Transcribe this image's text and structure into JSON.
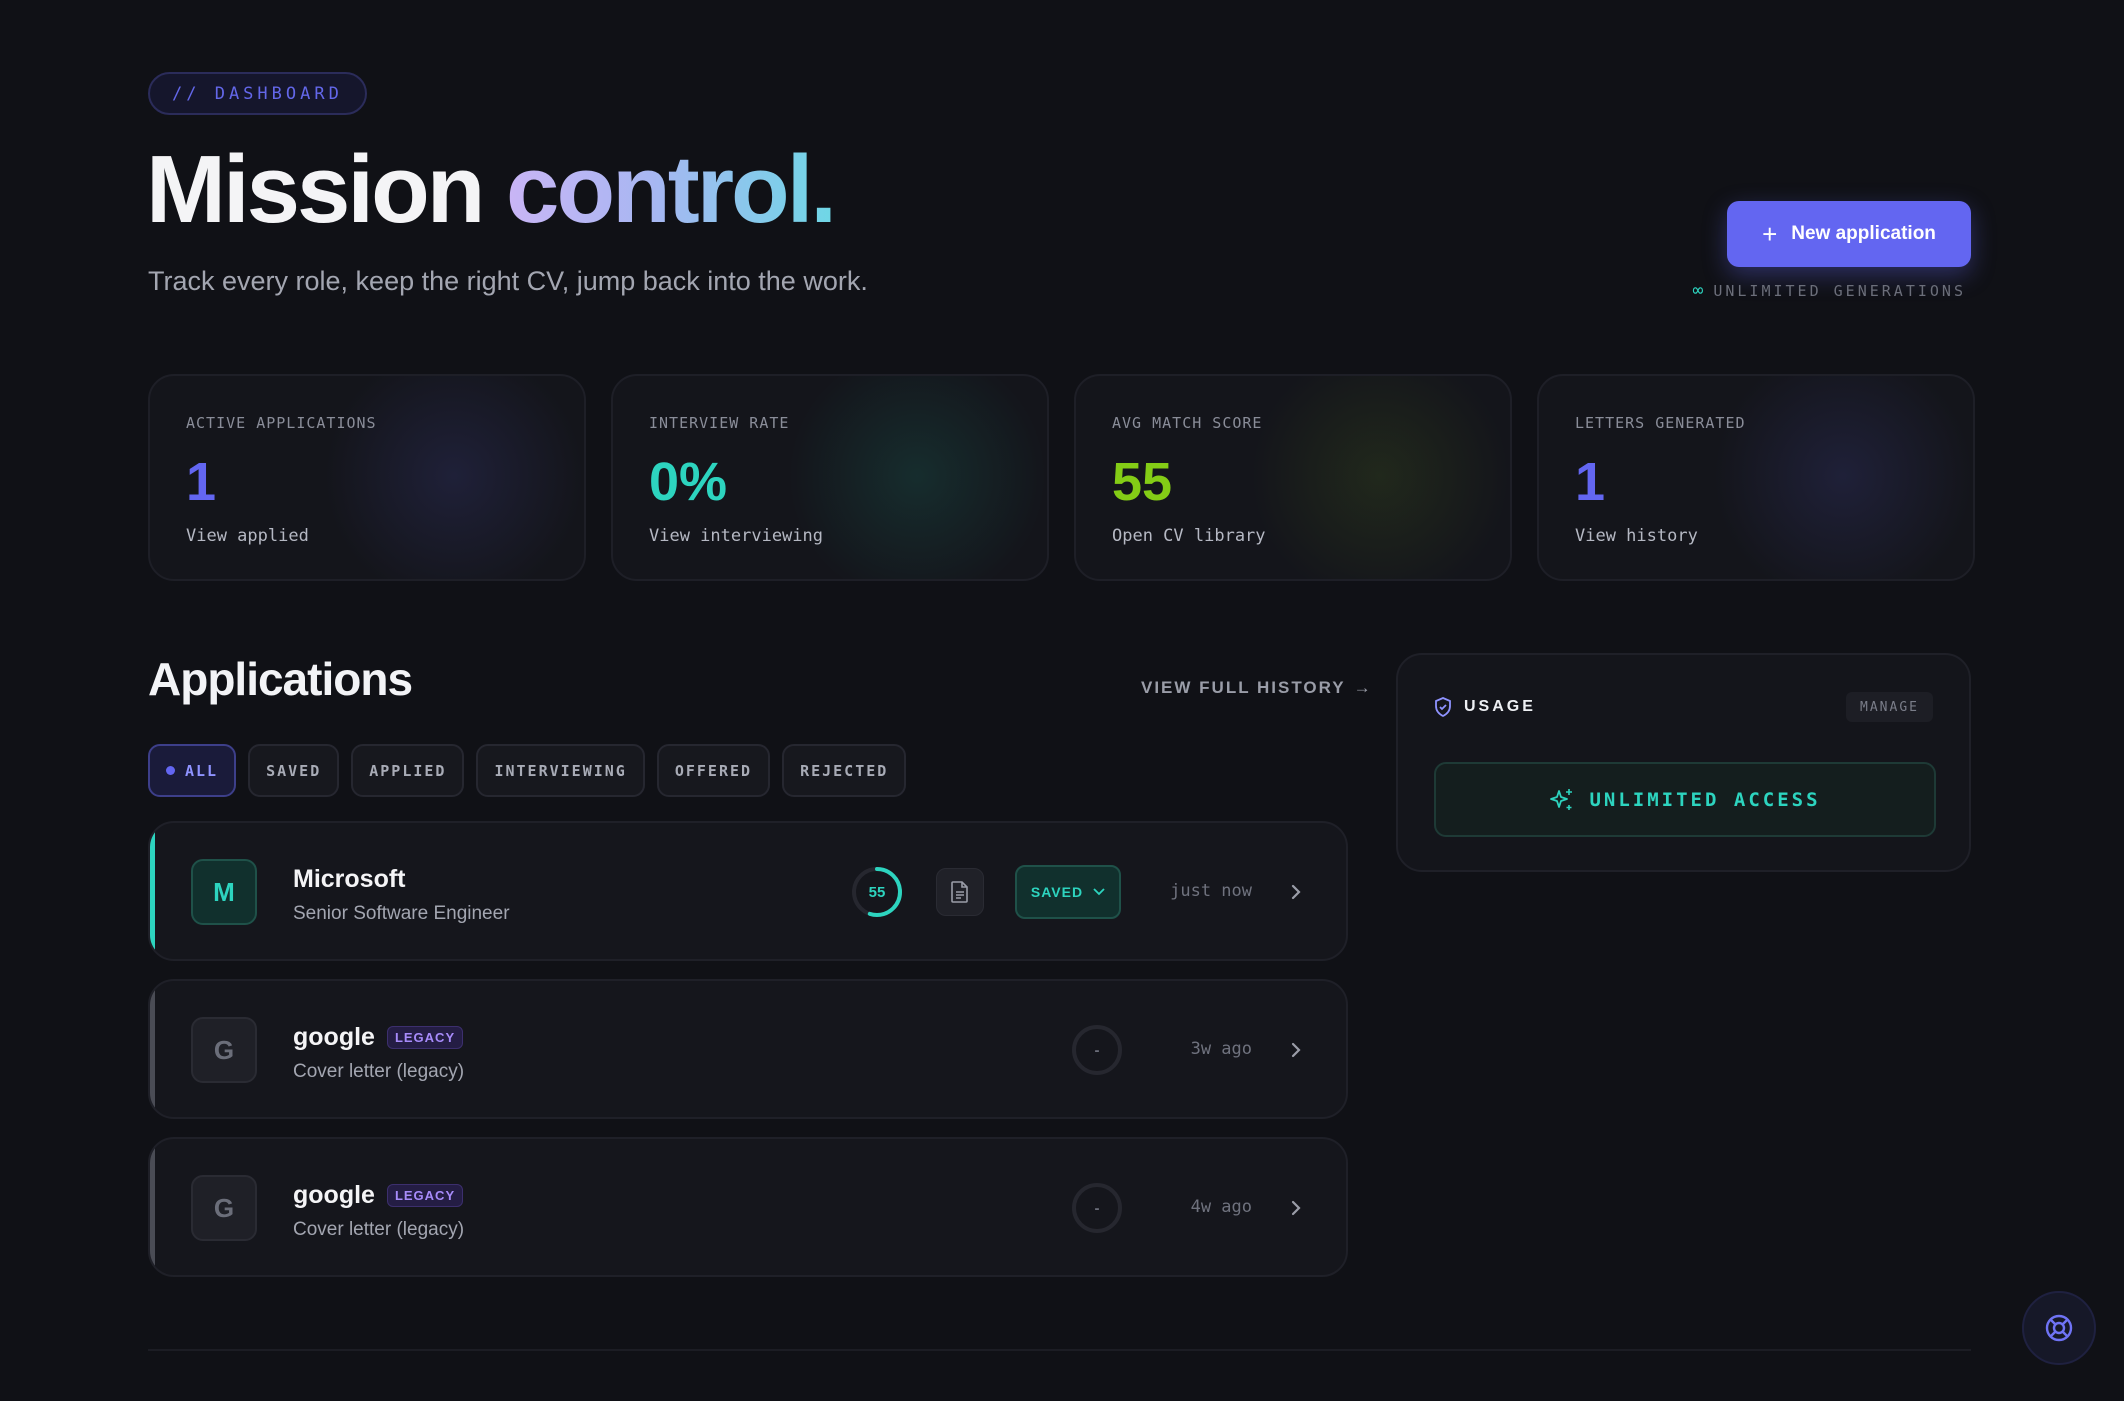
{
  "header": {
    "eyebrow": "// DASHBOARD",
    "headline_1": "Mission",
    "headline_2": "control.",
    "subtitle": "Track every role, keep the right CV, jump back into the work.",
    "new_button": "New application",
    "generations_icon": "∞",
    "generations_note": "UNLIMITED GENERATIONS"
  },
  "stats": [
    {
      "label": "ACTIVE APPLICATIONS",
      "value": "1",
      "link": "View applied",
      "color": "#6366f1",
      "glow": "rgba(70,72,160,0.22)"
    },
    {
      "label": "INTERVIEW RATE",
      "value": "0%",
      "link": "View interviewing",
      "color": "#2dd4bf",
      "glow": "rgba(30,140,120,0.20)"
    },
    {
      "label": "AVG MATCH SCORE",
      "value": "55",
      "link": "Open CV library",
      "color": "#84cc16",
      "glow": "rgba(100,140,30,0.16)"
    },
    {
      "label": "LETTERS GENERATED",
      "value": "1",
      "link": "View history",
      "color": "#6366f1",
      "glow": "rgba(70,72,160,0.22)"
    }
  ],
  "applications": {
    "title": "Applications",
    "history_link": "VIEW FULL HISTORY",
    "history_arrow": "→",
    "filters": [
      "ALL",
      "SAVED",
      "APPLIED",
      "INTERVIEWING",
      "OFFERED",
      "REJECTED"
    ],
    "active_filter": "ALL",
    "rows": [
      {
        "initial": "M",
        "company": "Microsoft",
        "badge": "",
        "role": "Senior Software Engineer",
        "score": "55",
        "score_fraction": 0.55,
        "status": "SAVED",
        "time": "just now",
        "accent": "#2dd4bf"
      },
      {
        "initial": "G",
        "company": "google",
        "badge": "LEGACY",
        "role": "Cover letter (legacy)",
        "score": "-",
        "score_fraction": 0,
        "status": "",
        "time": "3w ago",
        "accent": "#4a4c55"
      },
      {
        "initial": "G",
        "company": "google",
        "badge": "LEGACY",
        "role": "Cover letter (legacy)",
        "score": "-",
        "score_fraction": 0,
        "status": "",
        "time": "4w ago",
        "accent": "#4a4c55"
      }
    ]
  },
  "usage": {
    "title": "USAGE",
    "manage": "MANAGE",
    "access": "UNLIMITED ACCESS"
  },
  "colors": {
    "accent": "#6366f1",
    "teal": "#2dd4bf",
    "lime": "#84cc16",
    "legacy": "#a78bfa"
  }
}
